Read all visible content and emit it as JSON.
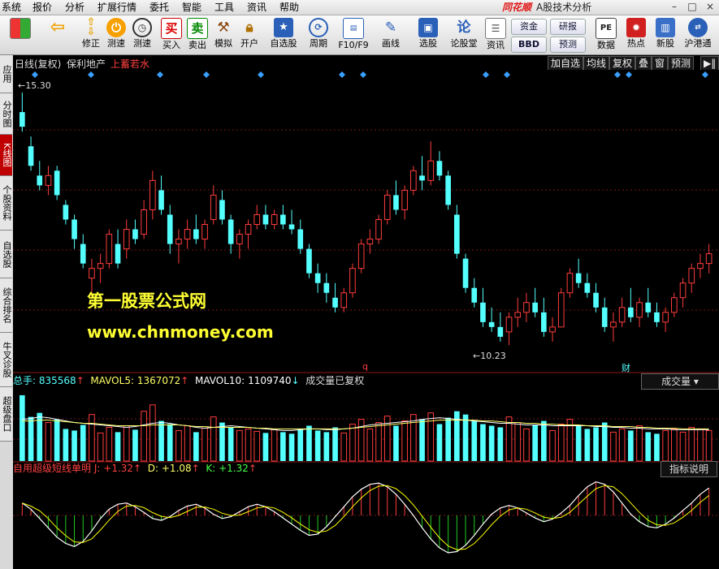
{
  "menu": [
    "系统",
    "报价",
    "分析",
    "扩展行情",
    "委托",
    "智能",
    "工具",
    "资讯",
    "帮助"
  ],
  "brand": {
    "logo": "同花顺",
    "title": "A股技术分析"
  },
  "window_controls": [
    "–",
    "□",
    "×"
  ],
  "toolbar": {
    "buttons": [
      {
        "label": "",
        "icon": "grid-icon"
      },
      {
        "label": "",
        "icon": "back-arrow-icon"
      },
      {
        "label": "修正",
        "icon": "up-down-arrows-icon"
      },
      {
        "label": "测速",
        "icon": "speed-icon"
      },
      {
        "label": "测速",
        "icon": "clock-icon"
      },
      {
        "label": "买入",
        "icon": "buy-icon",
        "glyph": "买"
      },
      {
        "label": "卖出",
        "icon": "sell-icon",
        "glyph": "卖"
      },
      {
        "label": "模拟",
        "icon": "hammer-icon"
      },
      {
        "label": "开户",
        "icon": "lock-icon"
      },
      {
        "label": "自选股",
        "icon": "star-icon"
      },
      {
        "label": "周期",
        "icon": "cycle-icon"
      },
      {
        "label": "F10/F9",
        "icon": "f10-icon"
      },
      {
        "label": "画线",
        "icon": "pen-icon"
      },
      {
        "label": "选股",
        "icon": "screen-icon"
      },
      {
        "label": "论股堂",
        "icon": "discuss-icon",
        "glyph": "论"
      },
      {
        "label": "资讯",
        "icon": "news-icon"
      },
      {
        "label": "数据",
        "icon": "pe-icon",
        "glyph": "PE"
      },
      {
        "label": "热点",
        "icon": "hot-icon"
      },
      {
        "label": "新股",
        "icon": "new-stock-icon"
      },
      {
        "label": "沪港通",
        "icon": "hk-connect-icon"
      }
    ],
    "small_buttons": [
      "资金",
      "BBD",
      "研报",
      "预测"
    ]
  },
  "side_tabs": [
    "应用",
    "分时图",
    "K线图",
    "个股资料",
    "自选股",
    "综合排名",
    "牛叉诊股",
    "超级盘口"
  ],
  "chart_header": {
    "period": "日线(复权)",
    "stock": "保利地产",
    "tag": "上蓄若水",
    "buttons": [
      "加自选",
      "均线",
      "复权",
      "叠",
      "窗",
      "预测"
    ]
  },
  "volume_header": {
    "total_label": "总手:",
    "total": "835568",
    "mavol5_label": "MAVOL5:",
    "mavol5": "1367072",
    "mavol10_label": "MAVOL10:",
    "mavol10": "1109740",
    "note": "成交量已复权",
    "dropdown": "成交量"
  },
  "indicator_header": {
    "name": "自用超级短线单明",
    "j_label": "J:",
    "j": "+1.32",
    "d_label": "D:",
    "d": "+1.08",
    "k_label": "K:",
    "k": "+1.32",
    "button": "指标说明"
  },
  "price_labels": {
    "high": "15.30",
    "low": "10.23"
  },
  "markers": {
    "q": "q",
    "cai": "财"
  },
  "watermark": {
    "line1": "第一股票公式网",
    "line2": "www.chnmoney.com"
  },
  "colors": {
    "up": "#ff3c3c",
    "down": "#54ffff",
    "bg": "#000000",
    "grid": "#701818",
    "kline": "#ffffff",
    "dline": "#ffff00"
  },
  "chart_data": {
    "type": "candlestick",
    "title": "",
    "price_high": 15.3,
    "price_low": 10.23,
    "candles": [
      [
        15.0,
        15.4,
        14.6,
        14.7
      ],
      [
        14.3,
        14.5,
        13.8,
        13.9
      ],
      [
        13.7,
        14.0,
        13.4,
        13.5
      ],
      [
        13.5,
        13.9,
        13.3,
        13.7
      ],
      [
        13.8,
        13.9,
        13.2,
        13.3
      ],
      [
        13.1,
        13.2,
        12.7,
        12.8
      ],
      [
        12.8,
        12.9,
        12.2,
        12.4
      ],
      [
        12.3,
        12.5,
        11.8,
        11.9
      ],
      [
        11.6,
        12.0,
        11.2,
        11.8
      ],
      [
        11.8,
        12.1,
        11.5,
        11.9
      ],
      [
        11.9,
        12.6,
        11.8,
        12.5
      ],
      [
        12.3,
        12.6,
        11.8,
        11.9
      ],
      [
        12.2,
        12.8,
        12.0,
        12.6
      ],
      [
        12.6,
        12.8,
        12.3,
        12.4
      ],
      [
        12.5,
        13.2,
        12.4,
        13.0
      ],
      [
        13.0,
        13.8,
        12.8,
        13.6
      ],
      [
        13.4,
        13.7,
        12.9,
        13.0
      ],
      [
        12.9,
        13.1,
        12.1,
        12.3
      ],
      [
        12.3,
        12.6,
        11.9,
        12.4
      ],
      [
        12.4,
        12.8,
        12.2,
        12.6
      ],
      [
        12.6,
        12.9,
        12.3,
        12.4
      ],
      [
        12.4,
        12.8,
        12.2,
        12.7
      ],
      [
        12.8,
        13.5,
        12.7,
        13.3
      ],
      [
        13.2,
        13.4,
        12.7,
        12.8
      ],
      [
        12.8,
        12.9,
        12.1,
        12.3
      ],
      [
        12.3,
        12.6,
        12.0,
        12.5
      ],
      [
        12.5,
        12.8,
        12.2,
        12.7
      ],
      [
        12.7,
        13.1,
        12.6,
        12.9
      ],
      [
        12.9,
        13.1,
        12.6,
        12.7
      ],
      [
        12.7,
        13.0,
        12.6,
        12.9
      ],
      [
        12.9,
        13.1,
        12.6,
        12.7
      ],
      [
        12.7,
        13.0,
        12.5,
        12.6
      ],
      [
        12.6,
        12.8,
        12.1,
        12.2
      ],
      [
        12.2,
        12.3,
        11.6,
        11.7
      ],
      [
        11.7,
        11.9,
        11.3,
        11.5
      ],
      [
        11.5,
        11.7,
        11.1,
        11.3
      ],
      [
        11.2,
        11.5,
        10.9,
        11.0
      ],
      [
        11.0,
        11.4,
        10.9,
        11.3
      ],
      [
        11.3,
        11.9,
        11.2,
        11.8
      ],
      [
        11.8,
        12.4,
        11.7,
        12.3
      ],
      [
        12.3,
        12.6,
        12.1,
        12.4
      ],
      [
        12.4,
        12.9,
        12.3,
        12.8
      ],
      [
        12.8,
        13.4,
        12.7,
        13.3
      ],
      [
        13.3,
        13.6,
        12.9,
        13.0
      ],
      [
        13.0,
        13.5,
        12.8,
        13.4
      ],
      [
        13.4,
        13.9,
        13.3,
        13.8
      ],
      [
        13.7,
        14.1,
        13.4,
        13.6
      ],
      [
        13.6,
        14.4,
        13.5,
        14.0
      ],
      [
        14.0,
        14.2,
        13.6,
        13.7
      ],
      [
        13.7,
        13.8,
        13.0,
        13.1
      ],
      [
        12.9,
        13.1,
        12.0,
        12.1
      ],
      [
        12.0,
        12.1,
        11.3,
        11.4
      ],
      [
        11.4,
        11.6,
        11.0,
        11.1
      ],
      [
        11.1,
        11.4,
        10.6,
        10.7
      ],
      [
        10.7,
        11.0,
        10.5,
        10.6
      ],
      [
        10.6,
        10.9,
        10.3,
        10.4
      ],
      [
        10.5,
        10.9,
        10.23,
        10.8
      ],
      [
        10.8,
        11.2,
        10.6,
        10.9
      ],
      [
        10.9,
        11.3,
        10.7,
        11.1
      ],
      [
        11.1,
        11.4,
        10.8,
        10.9
      ],
      [
        10.9,
        11.2,
        10.4,
        10.5
      ],
      [
        10.5,
        10.8,
        10.3,
        10.6
      ],
      [
        10.6,
        11.4,
        10.6,
        11.3
      ],
      [
        11.3,
        11.8,
        11.2,
        11.7
      ],
      [
        11.7,
        12.0,
        11.4,
        11.5
      ],
      [
        11.5,
        11.7,
        11.2,
        11.3
      ],
      [
        11.3,
        11.5,
        10.9,
        11.0
      ],
      [
        11.0,
        11.2,
        10.5,
        10.6
      ],
      [
        10.6,
        10.9,
        10.3,
        10.7
      ],
      [
        10.7,
        11.2,
        10.6,
        11.0
      ],
      [
        11.0,
        11.4,
        10.7,
        10.8
      ],
      [
        10.8,
        11.2,
        10.6,
        11.1
      ],
      [
        11.1,
        11.4,
        10.8,
        10.9
      ],
      [
        10.9,
        11.1,
        10.6,
        10.7
      ],
      [
        10.7,
        11.0,
        10.5,
        10.9
      ],
      [
        10.9,
        11.3,
        10.8,
        11.2
      ],
      [
        11.2,
        11.6,
        11.0,
        11.5
      ],
      [
        11.5,
        11.9,
        11.3,
        11.8
      ],
      [
        11.8,
        12.1,
        11.6,
        11.9
      ],
      [
        11.9,
        12.3,
        11.7,
        12.1
      ]
    ],
    "volume": [
      82,
      55,
      60,
      48,
      52,
      40,
      38,
      45,
      58,
      35,
      42,
      36,
      44,
      39,
      62,
      70,
      50,
      46,
      38,
      44,
      36,
      41,
      55,
      48,
      42,
      38,
      40,
      37,
      35,
      39,
      36,
      34,
      40,
      44,
      38,
      36,
      42,
      35,
      46,
      52,
      40,
      48,
      56,
      44,
      50,
      58,
      52,
      60,
      46,
      54,
      62,
      58,
      50,
      46,
      44,
      42,
      55,
      48,
      40,
      45,
      50,
      38,
      46,
      52,
      44,
      40,
      42,
      48,
      36,
      40,
      38,
      44,
      36,
      34,
      38,
      40,
      36,
      42,
      40,
      38
    ],
    "mavol5": [
      52,
      53,
      55,
      54,
      52,
      50,
      48,
      47,
      46,
      45,
      44,
      43,
      42,
      43,
      45,
      47,
      48,
      47,
      45,
      44,
      42,
      41,
      42,
      43,
      44,
      43,
      42,
      41,
      40,
      39,
      38,
      38,
      39,
      40,
      40,
      39,
      39,
      40,
      41,
      43,
      45,
      46,
      47,
      48,
      49,
      50,
      52,
      53,
      54,
      53,
      52,
      51,
      50,
      49,
      48,
      47,
      47,
      46,
      45,
      45,
      45,
      44,
      44,
      44,
      44,
      44,
      43,
      43,
      42,
      42,
      41,
      41,
      40,
      40,
      40,
      39,
      39,
      39,
      39,
      39
    ],
    "mavol10": [
      50,
      50,
      51,
      51,
      50,
      49,
      48,
      47,
      47,
      46,
      45,
      44,
      44,
      44,
      44,
      45,
      45,
      45,
      45,
      44,
      43,
      43,
      42,
      42,
      42,
      42,
      42,
      41,
      41,
      40,
      40,
      40,
      40,
      40,
      40,
      40,
      40,
      40,
      41,
      42,
      43,
      44,
      45,
      46,
      47,
      48,
      49,
      50,
      51,
      51,
      51,
      51,
      51,
      50,
      50,
      49,
      48,
      48,
      47,
      47,
      46,
      46,
      45,
      45,
      45,
      44,
      44,
      44,
      43,
      43,
      43,
      42,
      42,
      41,
      41,
      41,
      40,
      40,
      40,
      40
    ],
    "indicator": [
      20,
      10,
      -5,
      -20,
      -35,
      -45,
      -50,
      -42,
      -25,
      -5,
      10,
      18,
      20,
      14,
      5,
      -5,
      -8,
      -2,
      8,
      15,
      18,
      12,
      2,
      -5,
      -2,
      6,
      14,
      18,
      14,
      6,
      -4,
      -14,
      -24,
      -32,
      -30,
      -18,
      -2,
      14,
      30,
      42,
      50,
      52,
      46,
      34,
      18,
      0,
      -20,
      -38,
      -52,
      -60,
      -58,
      -48,
      -32,
      -14,
      2,
      12,
      16,
      12,
      4,
      -4,
      -10,
      -6,
      4,
      16,
      32,
      46,
      54,
      50,
      38,
      20,
      2,
      -10,
      -18,
      -20,
      -14,
      -4,
      8,
      20,
      34,
      44
    ]
  }
}
